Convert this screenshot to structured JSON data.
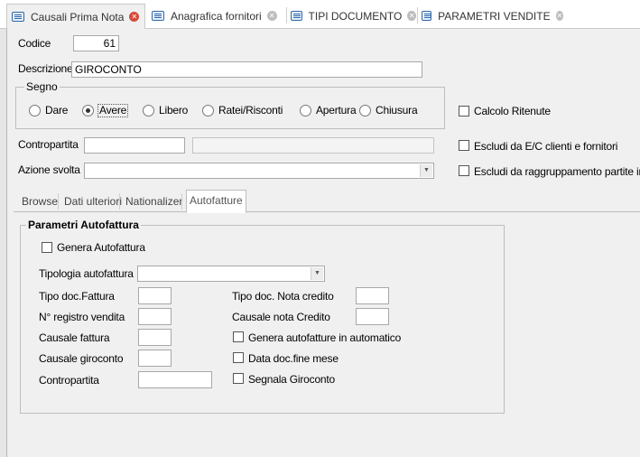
{
  "tabs": [
    {
      "label": "Causali Prima Nota",
      "active": true
    },
    {
      "label": "Anagrafica fornitori",
      "active": false
    },
    {
      "label": "TIPI DOCUMENTO",
      "active": false
    },
    {
      "label": "PARAMETRI VENDITE",
      "active": false
    }
  ],
  "form": {
    "codice_label": "Codice",
    "codice_value": "61",
    "descrizione_label": "Descrizione",
    "descrizione_value": "GIROCONTO",
    "segno_title": "Segno",
    "segno_options": [
      "Dare",
      "Avere",
      "Libero",
      "Ratei/Risconti",
      "Apertura",
      "Chiusura"
    ],
    "segno_selected": "Avere",
    "calcolo_ritenute_label": "Calcolo Ritenute",
    "contropartita_label": "Contropartita",
    "contropartita_code": "",
    "contropartita_desc": "",
    "escludi_ec_label": "Escludi da E/C clienti e fornitori",
    "azione_label": "Azione svolta",
    "azione_value": "",
    "escludi_raggr_label": "Escludi da raggruppamento partite in E/"
  },
  "subtabs": [
    "Browse",
    "Dati ulteriori",
    "Nationalizer",
    "Autofatture"
  ],
  "subtab_active": "Autofatture",
  "autofattura": {
    "title": "Parametri Autofattura",
    "genera_label": "Genera Autofattura",
    "tipologia_label": "Tipologia autofattura",
    "tipologia_value": "",
    "tipo_doc_fattura_label": "Tipo doc.Fattura",
    "tipo_doc_nota_label": "Tipo doc. Nota credito",
    "registro_label": "N° registro vendita",
    "causale_nota_label": "Causale nota Credito",
    "causale_fattura_label": "Causale fattura",
    "genera_auto_label": "Genera autofatture in automatico",
    "causale_giroconto_label": "Causale giroconto",
    "data_fine_mese_label": "Data doc.fine mese",
    "contropartita_label": "Contropartita",
    "segnala_label": "Segnala Giroconto"
  }
}
